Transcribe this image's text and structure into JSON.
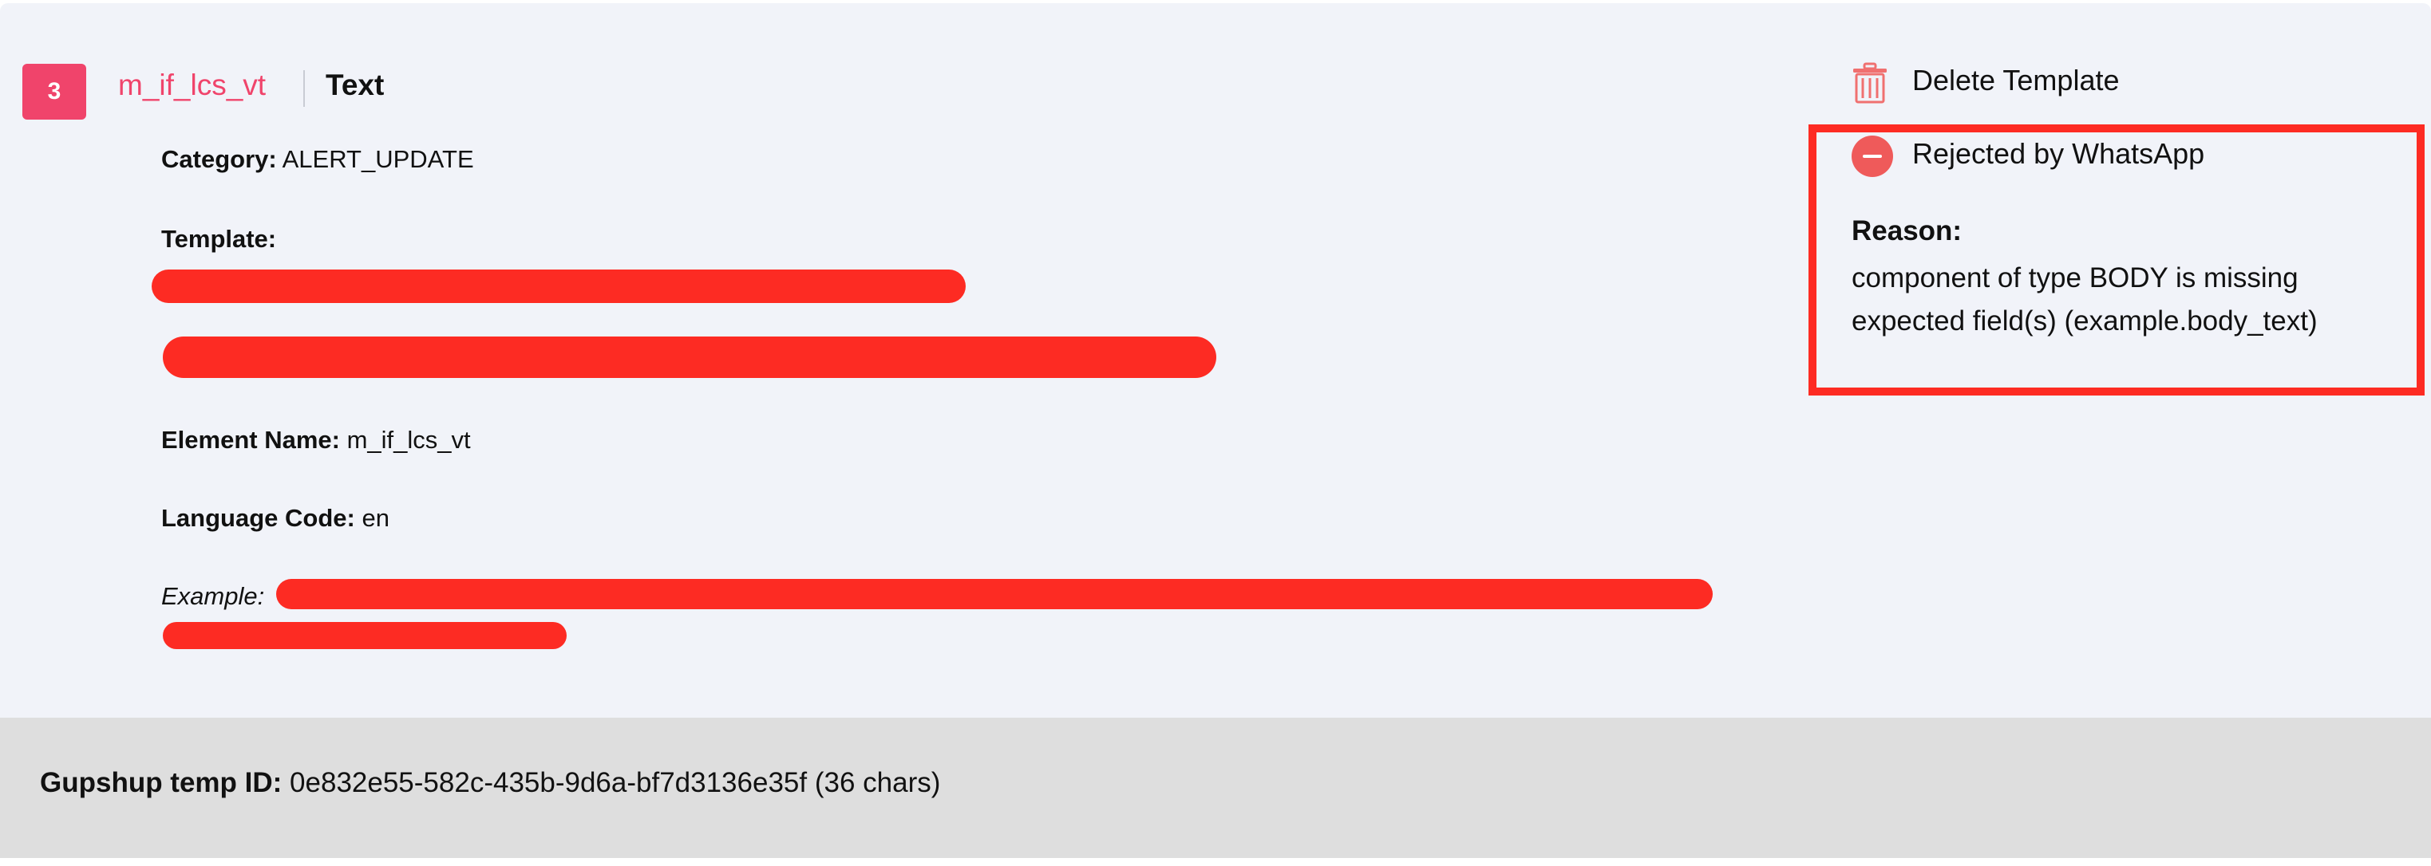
{
  "template": {
    "index": "3",
    "name": "m_if_lcs_vt",
    "type": "Text",
    "category_label": "Category:",
    "category_value": "ALERT_UPDATE",
    "template_label": "Template:",
    "element_name_label": "Element Name:",
    "element_name_value": "m_if_lcs_vt",
    "language_label": "Language Code:",
    "language_value": "en",
    "example_label": "Example:"
  },
  "actions": {
    "delete_label": "Delete Template",
    "status_label": "Rejected by WhatsApp"
  },
  "reason": {
    "title": "Reason:",
    "text": "component of type BODY is missing expected field(s) (example.body_text)"
  },
  "footer": {
    "label": "Gupshup temp ID:",
    "value": "0e832e55-582c-435b-9d6a-bf7d3136e35f (36 chars)"
  },
  "colors": {
    "accent": "#f0446b",
    "redaction": "#fd2b23",
    "rejected": "#ef5a5a",
    "card_bg": "#f1f3f9",
    "footer_bg": "#dedede"
  }
}
